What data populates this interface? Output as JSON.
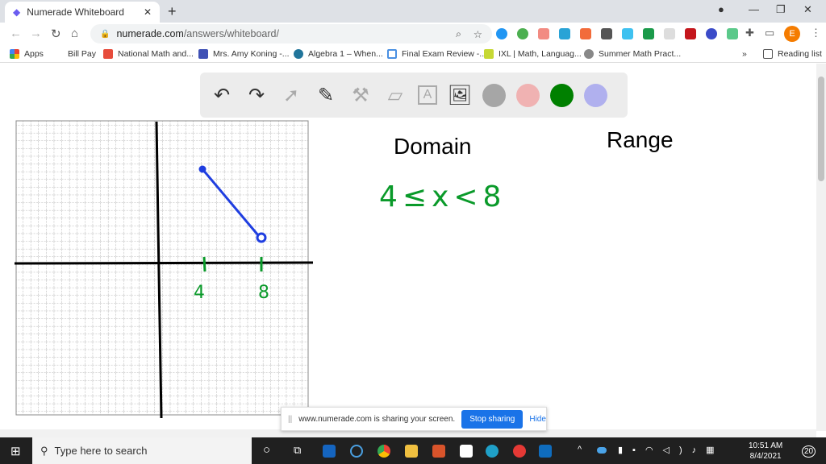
{
  "browser": {
    "tab_title": "Numerade Whiteboard",
    "url_host": "numerade.com",
    "url_path": "/answers/whiteboard/",
    "profile_initial": "E",
    "bookmarks": [
      "Apps",
      "Bill Pay",
      "National Math and...",
      "Mrs. Amy Koning -...",
      "Algebra 1 – When...",
      "Final Exam Review -...",
      "IXL | Math, Languag...",
      "Summer Math Pract..."
    ],
    "overflow": "»",
    "reading_list": "Reading list"
  },
  "whiteboard": {
    "tools": [
      "undo",
      "redo",
      "select",
      "pen",
      "tools",
      "eraser",
      "text",
      "image"
    ],
    "colors": [
      "#a6a6a6",
      "#f0b2b2",
      "#008000",
      "#b0b0ee"
    ],
    "heading_domain": "Domain",
    "heading_range": "Range",
    "domain_answer": "4≤x<8",
    "tick_labels": [
      "4",
      "8"
    ],
    "ink_blue": "#1f3ee0",
    "ink_green": "#0a9a2a"
  },
  "share_bar": {
    "message": "www.numerade.com is sharing your screen.",
    "stop": "Stop sharing",
    "hide": "Hide"
  },
  "taskbar": {
    "search_placeholder": "Type here to search",
    "time": "10:51 AM",
    "date": "8/4/2021",
    "notifications": "20"
  }
}
